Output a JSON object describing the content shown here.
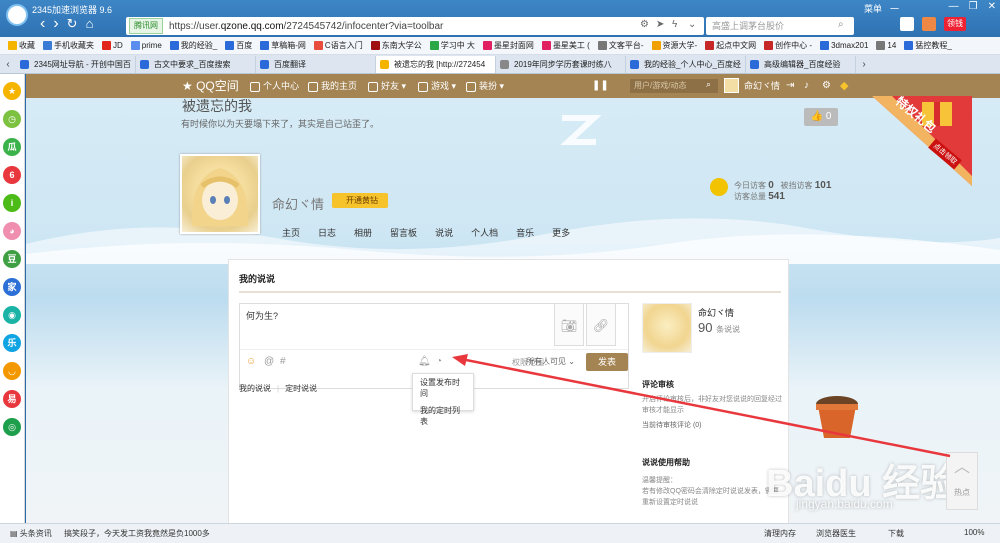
{
  "browser": {
    "title": "2345加速浏览器 9.6",
    "secure_badge": "腾讯网",
    "url_prefix": "https://user.",
    "url_domain": "qzone.qq.com",
    "url_path": "/2724545742/infocenter?via=toolbar",
    "search_placeholder": "高盛上调茅台股价",
    "top_right": [
      "菜单",
      "一"
    ],
    "coin_label": "领钱"
  },
  "bookmarks": [
    {
      "label": "收藏",
      "color": "#f5b400"
    },
    {
      "label": "手机收藏夹",
      "color": "#3a7bd5"
    },
    {
      "label": "JD",
      "color": "#e1251b"
    },
    {
      "label": "prime",
      "color": "#5a8dee"
    },
    {
      "label": "我的经验_",
      "color": "#2b6ad9"
    },
    {
      "label": "百度",
      "color": "#2b6ad9"
    },
    {
      "label": "草稿箱-网",
      "color": "#2b6ad9"
    },
    {
      "label": "C语言入门",
      "color": "#e84c3d"
    },
    {
      "label": "东南大学公",
      "color": "#a01010"
    },
    {
      "label": "学习中 大",
      "color": "#2aa845"
    },
    {
      "label": "墨星封面网",
      "color": "#e02060"
    },
    {
      "label": "墨星美工 (",
      "color": "#e02060"
    },
    {
      "label": "文客平台-",
      "color": "#777777"
    },
    {
      "label": "资源大学-",
      "color": "#f0a000"
    },
    {
      "label": "起点中文网",
      "color": "#c62828"
    },
    {
      "label": "创作中心 -",
      "color": "#c62828"
    },
    {
      "label": "3dmax201",
      "color": "#2b6ad9"
    },
    {
      "label": "14",
      "color": "#777777"
    },
    {
      "label": "猛控教程_",
      "color": "#2b6ad9"
    }
  ],
  "tabs": [
    {
      "label": "2345网址导航 - 开创中国百",
      "color": "#2b6ad9",
      "active": false
    },
    {
      "label": "古文中要求_百度搜索",
      "color": "#2b6ad9",
      "active": false
    },
    {
      "label": "百度翻译",
      "color": "#2b6ad9",
      "active": false
    },
    {
      "label": "被遗忘的我 [http://272454",
      "color": "#f5b400",
      "active": true
    },
    {
      "label": "2019年同步学历套课时练八",
      "color": "#888888",
      "active": false
    },
    {
      "label": "我的经验_个人中心_百度经",
      "color": "#2b6ad9",
      "active": false
    },
    {
      "label": "高级编辑器_百度经验",
      "color": "#2b6ad9",
      "active": false
    }
  ],
  "qzone": {
    "logo": "QQ空间",
    "nav": [
      "个人中心",
      "我的主页",
      "好友",
      "游戏",
      "装扮"
    ],
    "search_placeholder": "用户/游戏/动态",
    "user_short": "命幻ヾ情",
    "blog_title": "被遗忘的我",
    "blog_subtitle": "有时候你以为天要塌下来了，其实是自己站歪了。",
    "like_count": "0",
    "username": "命幻ヾ情",
    "vip_label": "开通黄钻",
    "stats": {
      "today_label": "今日访客",
      "today": "0",
      "blocked_label": "被挡访客",
      "blocked": "101",
      "total_label": "访客总量",
      "total": "541"
    },
    "subnav": [
      "主页",
      "日志",
      "相册",
      "留言板",
      "说说",
      "个人档",
      "音乐",
      "更多"
    ],
    "panel_title": "我的说说",
    "editor_text": "何为生?",
    "permission_label": "权限范围：",
    "permission_value": "所有人可见",
    "post_button": "发表",
    "dropdown": [
      "设置发布时间",
      "我的定时列表"
    ],
    "my_tabs": [
      "我的说说",
      "定时说说"
    ],
    "side": {
      "name": "命幻ヾ情",
      "count": "90",
      "count_unit": "条说说",
      "review_title": "评论审核",
      "review_text": "开启评论审核后，非好友对您说说的回复经过审核才能显示",
      "review_pending": "当前待审核评论 (0)",
      "help_title": "说说使用帮助",
      "help_tip": "温馨提醒：",
      "help_text": "若有修改QQ密码会清除定时说说发表，需要重新设置定时说说"
    },
    "totop_label": "热点",
    "gift_label": "特权礼包",
    "gift_btn": "点击领取",
    "watermark": "Baidu 经验",
    "watermark_url": "jingyan.baidu.com"
  },
  "status": {
    "news_label": "头条资讯",
    "news_text": "搞笑段子，今天发工资我竟然是负1000多",
    "right": [
      "清理内存",
      "浏览器医生",
      "下载",
      "100%"
    ]
  },
  "colors": {
    "nav_brown": "#a48453",
    "browser_blue": "#2f72b2",
    "arrow_red": "#e8383d"
  }
}
